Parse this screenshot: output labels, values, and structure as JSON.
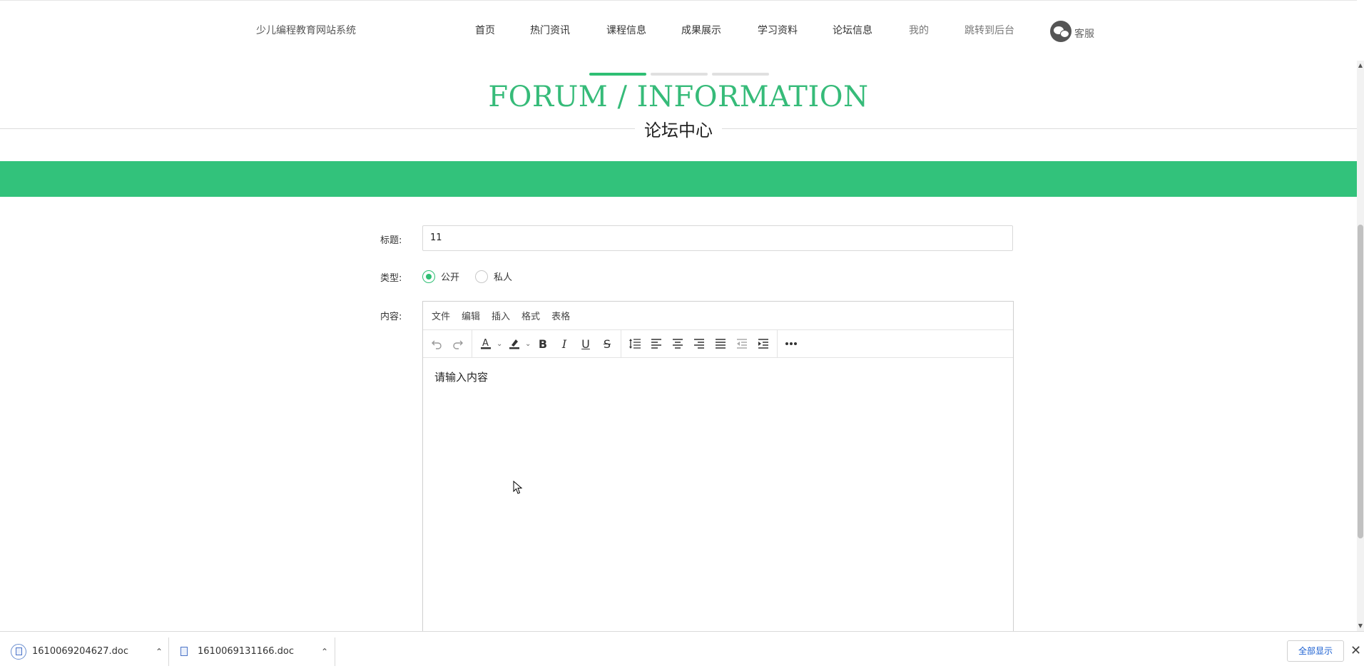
{
  "header": {
    "site_title": "少儿编程教育网站系统",
    "nav": [
      {
        "label": "首页"
      },
      {
        "label": "热门资讯"
      },
      {
        "label": "课程信息"
      },
      {
        "label": "成果展示"
      },
      {
        "label": "学习资料"
      },
      {
        "label": "论坛信息"
      },
      {
        "label": "我的"
      },
      {
        "label": "跳转到后台"
      }
    ],
    "service_label": "客服"
  },
  "hero": {
    "title": "FORUM / INFORMATION",
    "subtitle": "论坛中心",
    "accent_color": "#32c27b"
  },
  "form": {
    "title_label": "标题:",
    "title_value": "11",
    "type_label": "类型:",
    "type_options": [
      {
        "label": "公开",
        "checked": true
      },
      {
        "label": "私人",
        "checked": false
      }
    ],
    "content_label": "内容:"
  },
  "editor": {
    "menu": [
      "文件",
      "编辑",
      "插入",
      "格式",
      "表格"
    ],
    "toolbar_icons": [
      "undo-icon",
      "redo-icon",
      "text-color-icon",
      "highlight-color-icon",
      "bold-icon",
      "italic-icon",
      "underline-icon",
      "strikethrough-icon",
      "line-height-icon",
      "align-left-icon",
      "align-center-icon",
      "align-right-icon",
      "align-justify-icon",
      "outdent-icon",
      "indent-icon",
      "more-icon"
    ],
    "placeholder": "请输入内容"
  },
  "downloads": {
    "files": [
      {
        "name": "1610069204627.doc"
      },
      {
        "name": "1610069131166.doc"
      }
    ],
    "show_all": "全部显示"
  }
}
